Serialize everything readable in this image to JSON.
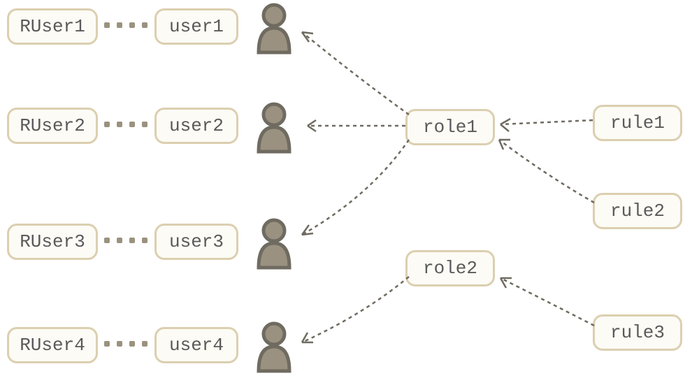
{
  "rusers": [
    {
      "label": "RUser1"
    },
    {
      "label": "RUser2"
    },
    {
      "label": "RUser3"
    },
    {
      "label": "RUser4"
    }
  ],
  "users": [
    {
      "label": "user1"
    },
    {
      "label": "user2"
    },
    {
      "label": "user3"
    },
    {
      "label": "user4"
    }
  ],
  "roles": [
    {
      "label": "role1"
    },
    {
      "label": "role2"
    }
  ],
  "rules": [
    {
      "label": "rule1"
    },
    {
      "label": "rule2"
    },
    {
      "label": "rule3"
    }
  ],
  "connections": {
    "role_to_user": [
      {
        "from": "role1",
        "to": [
          "user1",
          "user2",
          "user3"
        ]
      },
      {
        "from": "role2",
        "to": [
          "user4"
        ]
      }
    ],
    "rule_to_role": [
      {
        "from": "rule1",
        "to": "role1"
      },
      {
        "from": "rule2",
        "to": "role1"
      },
      {
        "from": "rule3",
        "to": "role2"
      }
    ],
    "ruser_to_user": [
      {
        "from": "RUser1",
        "to": "user1"
      },
      {
        "from": "RUser2",
        "to": "user2"
      },
      {
        "from": "RUser3",
        "to": "user3"
      },
      {
        "from": "RUser4",
        "to": "user4"
      }
    ]
  }
}
